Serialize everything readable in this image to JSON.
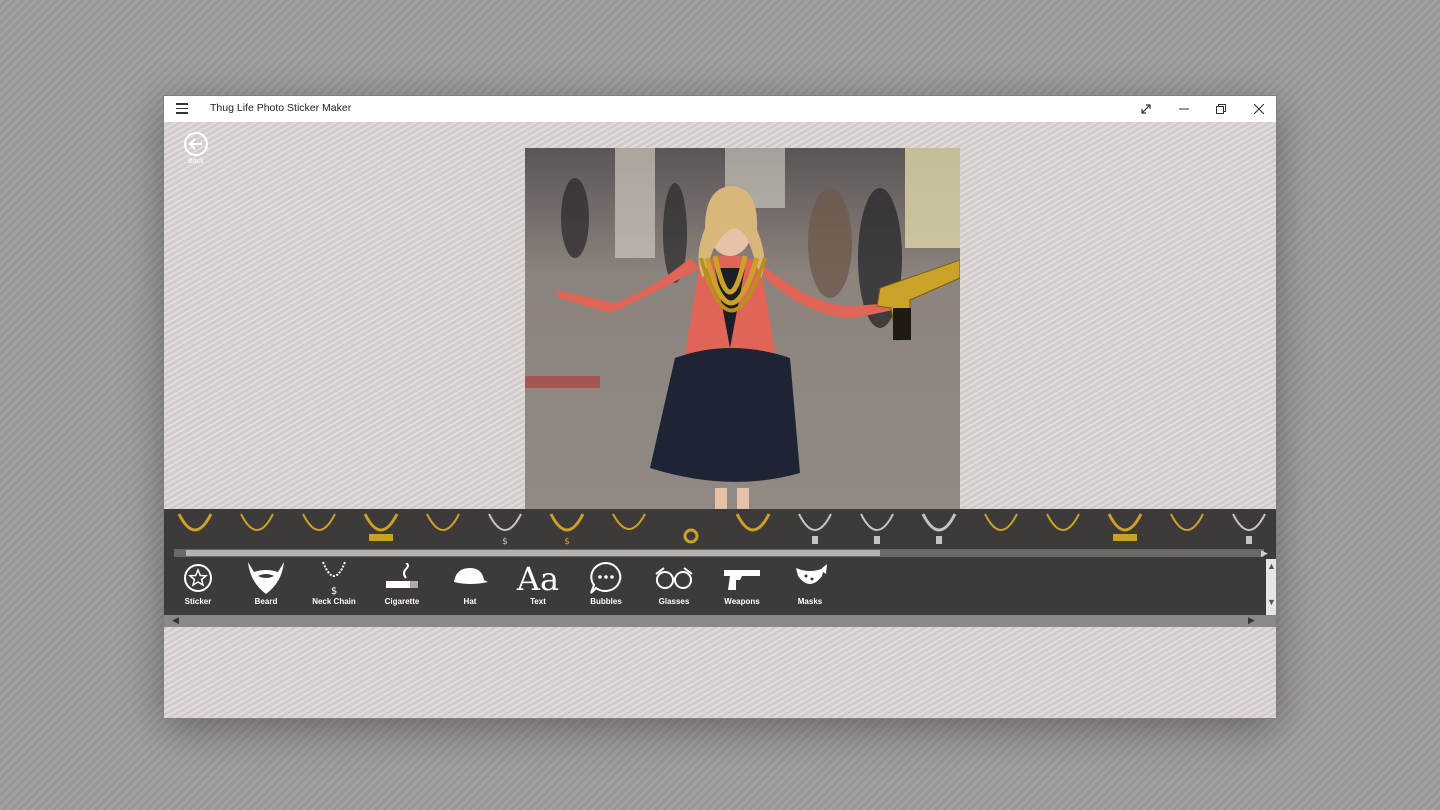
{
  "window": {
    "title": "Thug Life Photo Sticker Maker",
    "controls": [
      "fullscreen-icon",
      "minimize-icon",
      "restore-icon",
      "close-icon"
    ]
  },
  "back": {
    "label": "Back",
    "icon": "arrow-left-icon"
  },
  "colors": {
    "toolbar_bg": "#3d3a39",
    "content_bg": "#d8d2d0",
    "gold": "#c9a227",
    "silver": "#c4c4c4"
  },
  "sticker_strip": {
    "category": "Neck Chain",
    "items": [
      "gold-chain-1",
      "gold-chain-2",
      "gold-chain-3",
      "gold-chain-name",
      "gold-chain-4",
      "silver-chain-dollar",
      "gold-chain-dollar",
      "gold-chain-thin",
      "gold-ring-chain",
      "beaded-chain",
      "silver-pendant-1",
      "silver-pendant-2",
      "silver-pendant-3",
      "bead-chain-gold",
      "gold-gun-chain",
      "gold-plate-chain",
      "gold-chain-big",
      "silver-dogtag"
    ]
  },
  "tools": [
    {
      "label": "Sticker",
      "icon": "star-badge-icon"
    },
    {
      "label": "Beard",
      "icon": "beard-icon"
    },
    {
      "label": "Neck Chain",
      "icon": "necklace-icon"
    },
    {
      "label": "Cigarette",
      "icon": "cigarette-icon"
    },
    {
      "label": "Hat",
      "icon": "cap-icon"
    },
    {
      "label": "Text",
      "icon": "text-icon",
      "glyph": "Aa"
    },
    {
      "label": "Bubbles",
      "icon": "speech-bubble-icon"
    },
    {
      "label": "Glasses",
      "icon": "glasses-icon"
    },
    {
      "label": "Weapons",
      "icon": "pistol-icon"
    },
    {
      "label": "Masks",
      "icon": "bandana-icon"
    }
  ]
}
